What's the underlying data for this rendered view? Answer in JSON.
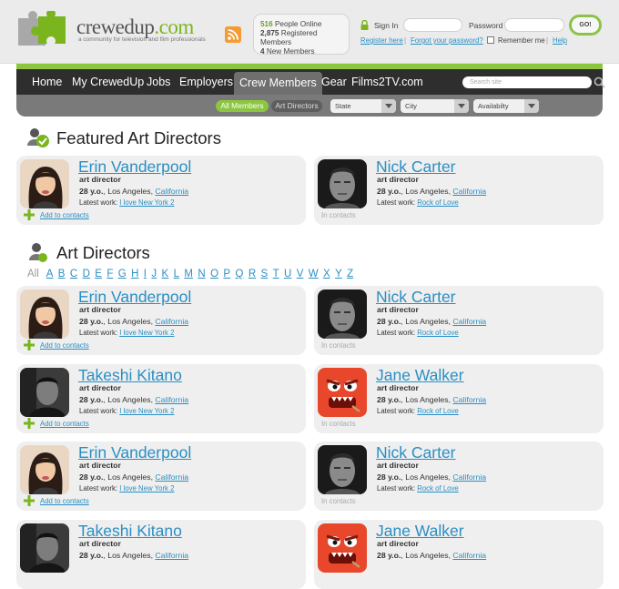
{
  "header": {
    "brand": "crewedup",
    "brand_tld": ".com",
    "tagline": "a community for television and film professionals",
    "stats": {
      "online_count": "516",
      "online_label": "People Online",
      "registered_count": "2,875",
      "registered_label": "Registered Members",
      "new_count": "4",
      "new_label": "New Members"
    },
    "signin_label": "Sign In",
    "password_label": "Password",
    "go_label": "GO!",
    "register_link": "Register here",
    "forgot_link": "Forgot your password?",
    "remember_label": "Remember me",
    "help_link": "Help"
  },
  "nav": {
    "items": [
      "Home",
      "My CrewedUp",
      "Jobs",
      "Employers",
      "Crew Members",
      "Gear",
      "Films2TV.com"
    ],
    "search_placeholder": "Search site"
  },
  "subnav": {
    "tab_all": "All Members",
    "tab_art": "Art Directors",
    "filters": [
      "State",
      "City",
      "Availabilty"
    ]
  },
  "featured_title": "Featured Art Directors",
  "list_title": "Art Directors",
  "alphabet": {
    "all": "All",
    "letters": [
      "A",
      "B",
      "C",
      "D",
      "E",
      "F",
      "G",
      "H",
      "I",
      "J",
      "K",
      "L",
      "M",
      "N",
      "O",
      "P",
      "Q",
      "R",
      "S",
      "T",
      "U",
      "V",
      "W",
      "X",
      "Y",
      "Z"
    ]
  },
  "card_labels": {
    "role": "art director",
    "latest_work": "Latest work:",
    "add_contact": "Add to contacts",
    "in_contacts": "In contacts"
  },
  "featured": [
    {
      "name": "Erin Vanderpool",
      "age": "28 y.o.",
      "city": "Los Angeles",
      "state": "California",
      "work": "I love New York 2",
      "contact": "add"
    },
    {
      "name": "Nick Carter",
      "age": "28 y.o.",
      "city": "Los Angeles",
      "state": "California",
      "work": "Rock of Love",
      "contact": "in"
    }
  ],
  "list": [
    {
      "name": "Erin Vanderpool",
      "age": "28 y.o.",
      "city": "Los Angeles",
      "state": "California",
      "work": "I love New York 2",
      "contact": "add"
    },
    {
      "name": "Nick Carter",
      "age": "28 y.o.",
      "city": "Los Angeles",
      "state": "California",
      "work": "Rock of Love",
      "contact": "in"
    },
    {
      "name": "Takeshi Kitano",
      "age": "28 y.o.",
      "city": "Los Angeles",
      "state": "California",
      "work": "I love New York 2",
      "contact": "add"
    },
    {
      "name": "Jane Walker",
      "age": "28 y.o.",
      "city": "Los Angeles",
      "state": "California",
      "work": "Rock of Love",
      "contact": "in"
    },
    {
      "name": "Erin Vanderpool",
      "age": "28 y.o.",
      "city": "Los Angeles",
      "state": "California",
      "work": "I love New York 2",
      "contact": "add"
    },
    {
      "name": "Nick Carter",
      "age": "28 y.o.",
      "city": "Los Angeles",
      "state": "California",
      "work": "Rock of Love",
      "contact": "in"
    },
    {
      "name": "Takeshi Kitano",
      "age": "28 y.o.",
      "city": "Los Angeles",
      "state": "California",
      "work": "",
      "contact": ""
    },
    {
      "name": "Jane Walker",
      "age": "28 y.o.",
      "city": "Los Angeles",
      "state": "California",
      "work": "",
      "contact": ""
    }
  ]
}
